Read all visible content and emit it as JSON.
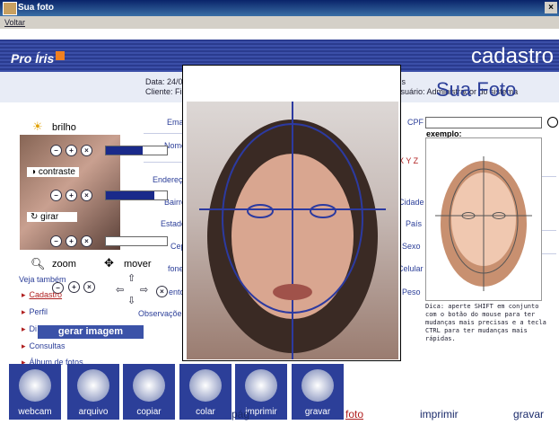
{
  "window": {
    "title": "Sua foto"
  },
  "menu": {
    "voltar": "Voltar"
  },
  "header": {
    "logo": "Pro Íris",
    "section": "cadastro"
  },
  "info": {
    "data_label": "Data:",
    "data_value": "24/0",
    "cliente_label": "Cliente:",
    "cliente_value": "Fi",
    "user_fragment": "Íris",
    "user_label": "Usuário:",
    "user_value": "Administrador do sistema"
  },
  "form": {
    "left_labels": [
      "Emai",
      "Nome",
      "Endereço",
      "Bairro",
      "Estado",
      "Cep",
      "fone",
      "ento"
    ],
    "observacoes": "Observações",
    "right_labels": [
      "Cidade",
      "País",
      "Sexo",
      "Celular",
      "Peso"
    ],
    "cpf": "CPF",
    "xyz": "X Y Z"
  },
  "controls": {
    "brilho": "brilho",
    "contraste": "contraste",
    "girar": "girar",
    "zoom": "zoom",
    "mover": "mover",
    "brilho_level": 0.6,
    "contraste_level": 0.8,
    "girar_level": 0.0
  },
  "sidebar": {
    "veja": "Veja também",
    "items": [
      "Cadastro",
      "Perfil",
      "Di",
      "Consultas",
      "Álbum de fotos"
    ]
  },
  "gerar": "gerar imagem",
  "photo": {
    "title": "Sua Foto"
  },
  "example": {
    "label": "exemplo:",
    "dica": "Dica: aperte SHIFT em conjunto com o botão do mouse para ter mudanças mais precisas e a tecla CTRL para ter mudanças mais rápidas."
  },
  "toolbar": [
    {
      "label": "webcam",
      "icon": "webcam-icon"
    },
    {
      "label": "arquivo",
      "icon": "floppy-disk-icon"
    },
    {
      "label": "copiar",
      "icon": "copy-icon"
    },
    {
      "label": "colar",
      "icon": "paste-icon"
    },
    {
      "label": "imprimir",
      "icon": "printer-icon"
    },
    {
      "label": "gravar",
      "icon": "cd-icon"
    }
  ],
  "bottom_nav": {
    "pag": "pág",
    "foto": "foto",
    "imprimir": "imprimir",
    "gravar": "gravar"
  },
  "colors": {
    "brand": "#2c3f99",
    "accent": "#b02020",
    "logo_orange": "#f08020"
  }
}
